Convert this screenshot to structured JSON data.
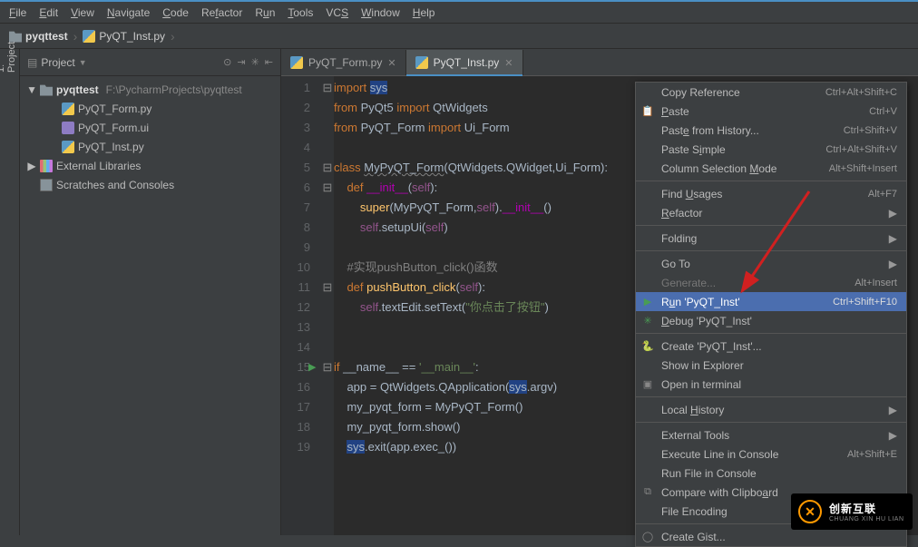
{
  "menu": [
    "File",
    "Edit",
    "View",
    "Navigate",
    "Code",
    "Refactor",
    "Run",
    "Tools",
    "VCS",
    "Window",
    "Help"
  ],
  "menu_underline": [
    0,
    0,
    0,
    0,
    0,
    2,
    1,
    0,
    2,
    0,
    0
  ],
  "breadcrumb": {
    "project": "pyqttest",
    "file": "PyQT_Inst.py"
  },
  "sidebar": {
    "title": "Project",
    "root": {
      "name": "pyqttest",
      "path": "F:\\PycharmProjects\\pyqttest"
    },
    "files": [
      "PyQT_Form.py",
      "PyQT_Form.ui",
      "PyQT_Inst.py"
    ],
    "extras": [
      "External Libraries",
      "Scratches and Consoles"
    ],
    "gutter_tab": "1: Project"
  },
  "tabs": [
    {
      "name": "PyQT_Form.py",
      "active": false
    },
    {
      "name": "PyQT_Inst.py",
      "active": true
    }
  ],
  "lines": [
    "import sys",
    "from PyQt5 import QtWidgets",
    "from PyQT_Form import Ui_Form",
    "",
    "class MyPyQT_Form(QtWidgets.QWidget,Ui_Form):",
    "    def __init__(self):",
    "        super(MyPyQT_Form,self).__init__()",
    "        self.setupUi(self)",
    "",
    "    #实现pushButton_click()函数",
    "    def pushButton_click(self):",
    "        self.textEdit.setText(\"你点击了按钮\")",
    "",
    "",
    "if __name__ == '__main__':",
    "    app = QtWidgets.QApplication(sys.argv)",
    "    my_pyqt_form = MyPyQT_Form()",
    "    my_pyqt_form.show()",
    "    sys.exit(app.exec_())"
  ],
  "context_menu": [
    {
      "label": "Copy Reference",
      "shortcut": "Ctrl+Alt+Shift+C"
    },
    {
      "label": "Paste",
      "shortcut": "Ctrl+V",
      "icon": "paste",
      "u": 0
    },
    {
      "label": "Paste from History...",
      "shortcut": "Ctrl+Shift+V",
      "u": 4
    },
    {
      "label": "Paste Simple",
      "shortcut": "Ctrl+Alt+Shift+V",
      "u": 7
    },
    {
      "label": "Column Selection Mode",
      "shortcut": "Alt+Shift+Insert",
      "u": 17
    },
    {
      "sep": true
    },
    {
      "label": "Find Usages",
      "shortcut": "Alt+F7",
      "u": 5
    },
    {
      "label": "Refactor",
      "submenu": true,
      "u": 0
    },
    {
      "sep": true
    },
    {
      "label": "Folding",
      "submenu": true
    },
    {
      "sep": true
    },
    {
      "label": "Go To",
      "submenu": true
    },
    {
      "label": "Generate...",
      "shortcut": "Alt+Insert",
      "muted": true
    },
    {
      "label": "Run 'PyQT_Inst'",
      "shortcut": "Ctrl+Shift+F10",
      "highlight": true,
      "icon": "run",
      "u": 1
    },
    {
      "label": "Debug 'PyQT_Inst'",
      "icon": "debug",
      "u": 0
    },
    {
      "sep": true
    },
    {
      "label": "Create 'PyQT_Inst'...",
      "icon": "python"
    },
    {
      "label": "Show in Explorer"
    },
    {
      "label": "Open in terminal",
      "icon": "terminal"
    },
    {
      "sep": true
    },
    {
      "label": "Local History",
      "submenu": true,
      "u": 6
    },
    {
      "sep": true
    },
    {
      "label": "External Tools",
      "submenu": true
    },
    {
      "label": "Execute Line in Console",
      "shortcut": "Alt+Shift+E"
    },
    {
      "label": "Run File in Console"
    },
    {
      "label": "Compare with Clipboard",
      "icon": "compare",
      "u": 19
    },
    {
      "label": "File Encoding"
    },
    {
      "sep": true
    },
    {
      "label": "Create Gist...",
      "icon": "gist"
    }
  ],
  "watermark": {
    "brand": "创新互联",
    "sub": "CHUANG XIN HU LIAN"
  }
}
